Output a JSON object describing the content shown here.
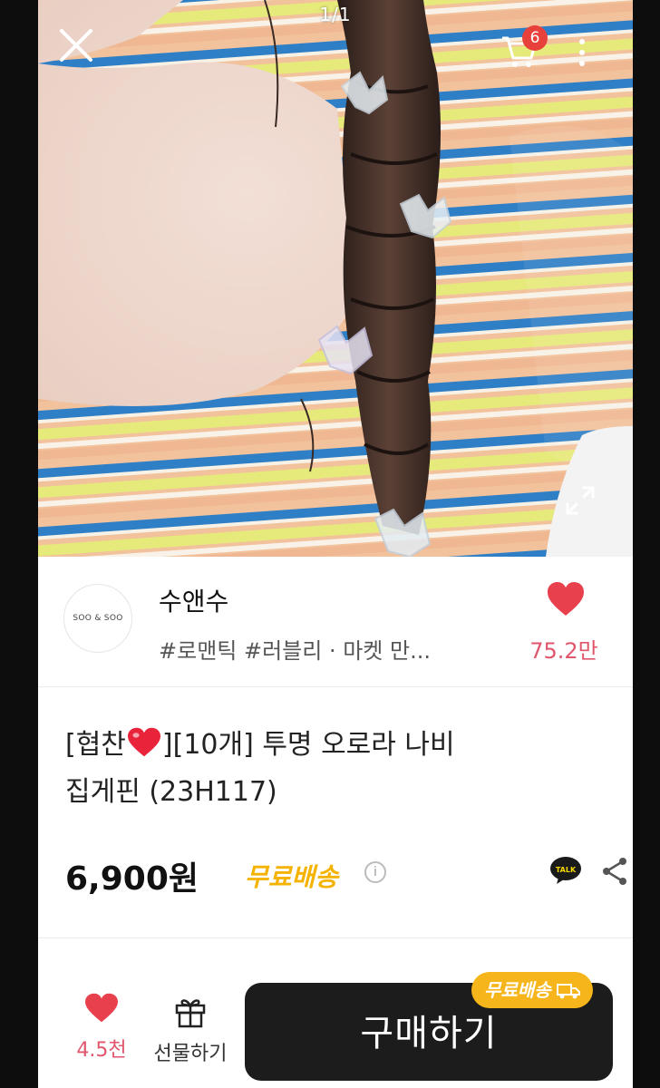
{
  "viewer": {
    "page_counter": "1/1"
  },
  "header": {
    "cart_count": "6"
  },
  "shop": {
    "logo_text": "SOO & SOO",
    "name": "수앤수",
    "tags": "#로맨틱 #러블리 · 마켓 만...",
    "likes": "75.2만"
  },
  "product": {
    "title_line1_a": "[협찬",
    "title_line1_b": "][10개] 투명 오로라 나비",
    "title_line2": "집게핀 (23H117)",
    "price": "6,900원",
    "shipping": "무료배송",
    "info_symbol": "i",
    "talk_label": "TALK"
  },
  "bottom_bar": {
    "like_count": "4.5천",
    "gift_label": "선물하기",
    "buy_label": "구매하기",
    "buy_tag": "무료배송"
  },
  "colors": {
    "accent_pink": "#e0566c",
    "heart_red": "#e8414d",
    "shipping_yellow": "#f5b300",
    "buy_dark": "#1c1c1c"
  },
  "icons": [
    "close-icon",
    "cart-icon",
    "more-icon",
    "expand-icon",
    "heart-icon",
    "info-icon",
    "kakao-talk-icon",
    "share-icon",
    "gift-icon",
    "truck-icon"
  ]
}
